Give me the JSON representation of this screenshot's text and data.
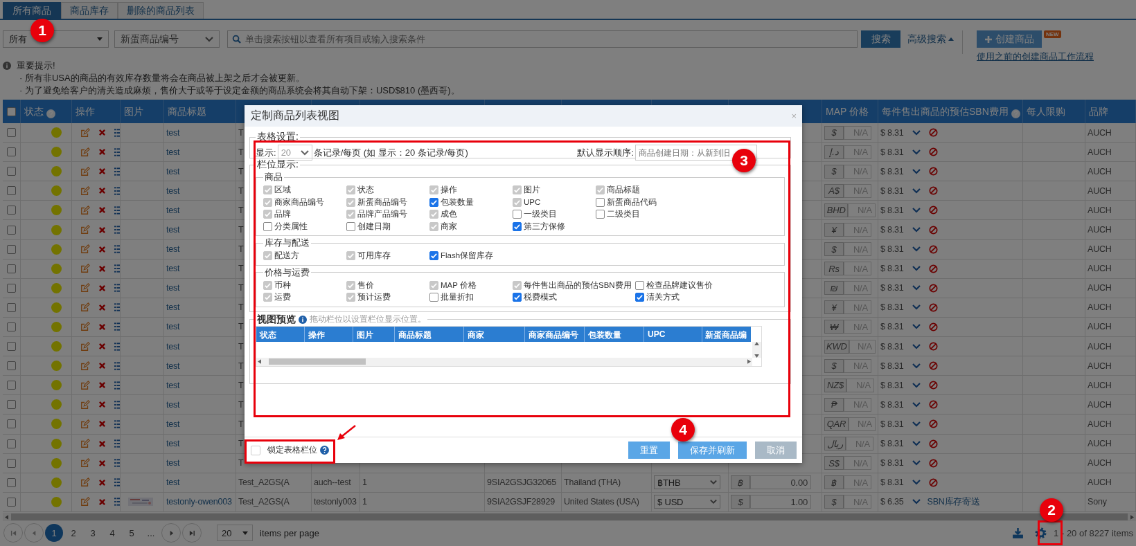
{
  "tabs": [
    {
      "label": "所有商品",
      "selected": true
    },
    {
      "label": "商品库存",
      "selected": false
    },
    {
      "label": "删除的商品列表",
      "selected": false
    }
  ],
  "filters": {
    "scope": "所有",
    "field": "新蛋商品编号",
    "search_placeholder": "单击搜索按钮以查看所有项目或输入搜索条件",
    "search_button": "搜索",
    "advanced_search": "高级搜索",
    "create_button": "创建商品",
    "new_badge": "NEW",
    "legacy_link": "使用之前的创建商品工作流程"
  },
  "notice": {
    "title": "重要提示!",
    "lines": [
      "· 所有非USA的商品的有效库存数量将会在商品被上架之后才会被更新。",
      "· 为了避免给客户的清关造成麻烦，售价大于或等于设定金额的商品系统会将其自动下架：USD$810 (墨西哥)。"
    ]
  },
  "table": {
    "columns": [
      {
        "kind": "checkbox",
        "checked": false
      },
      {
        "kind": "text",
        "label": "状态",
        "help": true
      },
      {
        "kind": "text",
        "label": "操作",
        "help": false
      },
      {
        "kind": "text",
        "label": "图片",
        "help": false
      },
      {
        "kind": "text",
        "label": "商品标题",
        "help": false
      },
      {
        "kind": "blank"
      },
      {
        "kind": "blank"
      },
      {
        "kind": "blank"
      },
      {
        "kind": "blank"
      },
      {
        "kind": "blank"
      },
      {
        "kind": "blank"
      },
      {
        "kind": "blank"
      },
      {
        "kind": "text",
        "label": "MAP 价格",
        "help": false
      },
      {
        "kind": "text",
        "label": "每件售出商品的预估SBN费用",
        "help": true
      },
      {
        "kind": "text",
        "label": "每人限购",
        "help": false
      },
      {
        "kind": "text",
        "label": "品牌",
        "help": false
      }
    ],
    "rows": [
      {
        "checked": false,
        "title": "test",
        "column_6": "T",
        "map_symbol": "$",
        "map_value": "N/A",
        "sbn_fee": "$ 8.31",
        "sbn_blocked": true,
        "brand": "AUCH"
      },
      {
        "checked": false,
        "title": "test",
        "column_6": "T",
        "map_symbol": "د.إ",
        "map_value": "N/A",
        "sbn_fee": "$ 8.31",
        "sbn_blocked": true,
        "brand": "AUCH"
      },
      {
        "checked": false,
        "title": "test",
        "column_6": "T",
        "map_symbol": "$",
        "map_value": "N/A",
        "sbn_fee": "$ 8.31",
        "sbn_blocked": true,
        "brand": "AUCH"
      },
      {
        "checked": false,
        "title": "test",
        "column_6": "T",
        "map_symbol": "A$",
        "map_value": "N/A",
        "sbn_fee": "$ 8.31",
        "sbn_blocked": true,
        "brand": "AUCH"
      },
      {
        "checked": false,
        "title": "test",
        "column_6": "T",
        "map_symbol": "BHD",
        "map_value": "N/A",
        "sbn_fee": "$ 8.31",
        "sbn_blocked": true,
        "brand": "AUCH"
      },
      {
        "checked": false,
        "title": "test",
        "column_6": "T",
        "map_symbol": "¥",
        "map_value": "N/A",
        "sbn_fee": "$ 8.31",
        "sbn_blocked": true,
        "brand": "AUCH"
      },
      {
        "checked": false,
        "title": "test",
        "column_6": "T",
        "map_symbol": "$",
        "map_value": "N/A",
        "sbn_fee": "$ 8.31",
        "sbn_blocked": true,
        "brand": "AUCH"
      },
      {
        "checked": false,
        "title": "test",
        "column_6": "T",
        "map_symbol": "Rs",
        "map_value": "N/A",
        "sbn_fee": "$ 8.31",
        "sbn_blocked": true,
        "brand": "AUCH"
      },
      {
        "checked": false,
        "title": "test",
        "column_6": "T",
        "map_symbol": "₪",
        "map_value": "N/A",
        "sbn_fee": "$ 8.31",
        "sbn_blocked": true,
        "brand": "AUCH"
      },
      {
        "checked": false,
        "title": "test",
        "column_6": "T",
        "map_symbol": "¥",
        "map_value": "N/A",
        "sbn_fee": "$ 8.31",
        "sbn_blocked": true,
        "brand": "AUCH"
      },
      {
        "checked": false,
        "title": "test",
        "column_6": "T",
        "map_symbol": "₩",
        "map_value": "N/A",
        "sbn_fee": "$ 8.31",
        "sbn_blocked": true,
        "brand": "AUCH"
      },
      {
        "checked": false,
        "title": "test",
        "column_6": "T",
        "map_symbol": "KWD",
        "map_value": "N/A",
        "sbn_fee": "$ 8.31",
        "sbn_blocked": true,
        "brand": "AUCH"
      },
      {
        "checked": false,
        "title": "test",
        "column_6": "T",
        "map_symbol": "$",
        "map_value": "N/A",
        "sbn_fee": "$ 8.31",
        "sbn_blocked": true,
        "brand": "AUCH"
      },
      {
        "checked": false,
        "title": "test",
        "column_6": "T",
        "map_symbol": "NZ$",
        "map_value": "N/A",
        "sbn_fee": "$ 8.31",
        "sbn_blocked": true,
        "brand": "AUCH"
      },
      {
        "checked": false,
        "title": "test",
        "column_6": "T",
        "map_symbol": "₱",
        "map_value": "N/A",
        "sbn_fee": "$ 8.31",
        "sbn_blocked": true,
        "brand": "AUCH"
      },
      {
        "checked": false,
        "title": "test",
        "column_6": "T",
        "map_symbol": "QAR",
        "map_value": "N/A",
        "sbn_fee": "$ 8.31",
        "sbn_blocked": true,
        "brand": "AUCH"
      },
      {
        "checked": false,
        "title": "test",
        "column_6": "T",
        "map_symbol": "ريال",
        "map_value": "N/A",
        "sbn_fee": "$ 8.31",
        "sbn_blocked": true,
        "brand": "AUCH"
      },
      {
        "checked": false,
        "title": "test",
        "column_6": "T",
        "map_symbol": "S$",
        "map_value": "N/A",
        "sbn_fee": "$ 8.31",
        "sbn_blocked": true,
        "brand": "AUCH"
      },
      {
        "checked": false,
        "title": "test",
        "column_6": "Test_A2GS(A",
        "column_7": "auch--test",
        "column_8": "1",
        "column_9": "9SIA2GSJG32065",
        "column_10": "Thailand (THA)",
        "column_11": "฿THB",
        "column_12_symbol": "฿",
        "column_12_value": "0.00",
        "map_symbol": "฿",
        "map_value": "N/A",
        "sbn_fee": "$ 8.31",
        "sbn_blocked": true,
        "brand": "AUCH"
      },
      {
        "checked": false,
        "title": "testonly-owen003",
        "column_6": "Test_A2GS(A",
        "column_7": "testonly003",
        "column_8": "1",
        "column_9": "9SIA2GSJF28929",
        "column_10": "United States (USA)",
        "column_11": "$ USD",
        "column_12_symbol": "$",
        "column_12_value": "1.00",
        "map_symbol": "$",
        "map_value": "N/A",
        "sbn_fee": "$ 6.35",
        "sbn_blocked": false,
        "sbn_link": "SBN库存寄送",
        "brand": "Sony"
      }
    ]
  },
  "pager": {
    "pages": [
      {
        "label": "1",
        "selected": true
      },
      {
        "label": "2",
        "selected": false
      },
      {
        "label": "3",
        "selected": false
      },
      {
        "label": "4",
        "selected": false
      },
      {
        "label": "5",
        "selected": false
      },
      {
        "label": "...",
        "selected": false
      }
    ],
    "page_size": "20",
    "page_size_label": "items per page",
    "summary": "1 - 20 of 8227 items"
  },
  "dialog": {
    "title": "定制商品列表视图",
    "close": "×",
    "table_settings": {
      "legend": "表格设置:",
      "show_label": "显示:",
      "page_size": "20",
      "page_size_suffix": "条记录/每页 (如 显示：20 条记录/每页)",
      "sort_label": "默认显示顺序:",
      "sort_placeholder": "商品创建日期：从新到旧"
    },
    "columns_legend": "栏位显示:",
    "groups": [
      {
        "title": "商品",
        "rows": [
          [
            {
              "label": "区域",
              "checked": true,
              "disabled": true
            },
            {
              "label": "状态",
              "checked": true,
              "disabled": true
            },
            {
              "label": "操作",
              "checked": true,
              "disabled": true
            },
            {
              "label": "图片",
              "checked": true,
              "disabled": true
            },
            {
              "label": "商品标题",
              "checked": true,
              "disabled": true
            }
          ],
          [
            {
              "label": "商家商品编号",
              "checked": true,
              "disabled": true
            },
            {
              "label": "新蛋商品编号",
              "checked": true,
              "disabled": true
            },
            {
              "label": "包装数量",
              "checked": true,
              "disabled": false
            },
            {
              "label": "UPC",
              "checked": true,
              "disabled": true
            },
            {
              "label": "新蛋商品代码",
              "checked": false,
              "disabled": false
            }
          ],
          [
            {
              "label": "品牌",
              "checked": true,
              "disabled": true
            },
            {
              "label": "品牌产品编号",
              "checked": true,
              "disabled": true
            },
            {
              "label": "成色",
              "checked": true,
              "disabled": true
            },
            {
              "label": "一级类目",
              "checked": false,
              "disabled": false
            },
            {
              "label": "二级类目",
              "checked": false,
              "disabled": false
            }
          ],
          [
            {
              "label": "分类属性",
              "checked": false,
              "disabled": false
            },
            {
              "label": "创建日期",
              "checked": false,
              "disabled": false
            },
            {
              "label": "商家",
              "checked": true,
              "disabled": true
            },
            {
              "label": "第三方保修",
              "checked": true,
              "disabled": false
            }
          ]
        ]
      },
      {
        "title": "库存与配送",
        "rows": [
          [
            {
              "label": "配送方",
              "checked": true,
              "disabled": true
            },
            {
              "label": "可用库存",
              "checked": true,
              "disabled": true
            },
            {
              "label": "Flash保留库存",
              "checked": true,
              "disabled": false
            }
          ]
        ]
      },
      {
        "title": "价格与运费",
        "rows": [
          [
            {
              "label": "币种",
              "checked": true,
              "disabled": true
            },
            {
              "label": "售价",
              "checked": true,
              "disabled": true
            },
            {
              "label": "MAP 价格",
              "checked": true,
              "disabled": true
            },
            {
              "label": "每件售出商品的预估SBN费用",
              "checked": true,
              "disabled": true
            },
            {
              "label": "检查品牌建议售价",
              "checked": false,
              "disabled": false
            }
          ],
          [
            {
              "label": "运费",
              "checked": true,
              "disabled": true
            },
            {
              "label": "预计运费",
              "checked": true,
              "disabled": true
            },
            {
              "label": "批量折扣",
              "checked": false,
              "disabled": false
            },
            {
              "label": "税费模式",
              "checked": true,
              "disabled": false
            },
            {
              "label": "清关方式",
              "checked": true,
              "disabled": false
            }
          ]
        ]
      }
    ],
    "preview": {
      "legend": "视图预览",
      "hint": "拖动栏位以设置栏位显示位置。",
      "columns": [
        "状态",
        "操作",
        "图片",
        "商品标题",
        "商家",
        "商家商品编号",
        "包装数量",
        "UPC",
        "新蛋商品编"
      ]
    },
    "lock": {
      "label": "锁定表格栏位",
      "checked": false
    },
    "buttons": [
      {
        "label": "重置",
        "disabled": false
      },
      {
        "label": "保存并刷新",
        "disabled": false
      },
      {
        "label": "取消",
        "disabled": true
      }
    ]
  },
  "annotations": [
    {
      "label": "1"
    },
    {
      "label": "2"
    },
    {
      "label": "3"
    },
    {
      "label": "4"
    }
  ]
}
